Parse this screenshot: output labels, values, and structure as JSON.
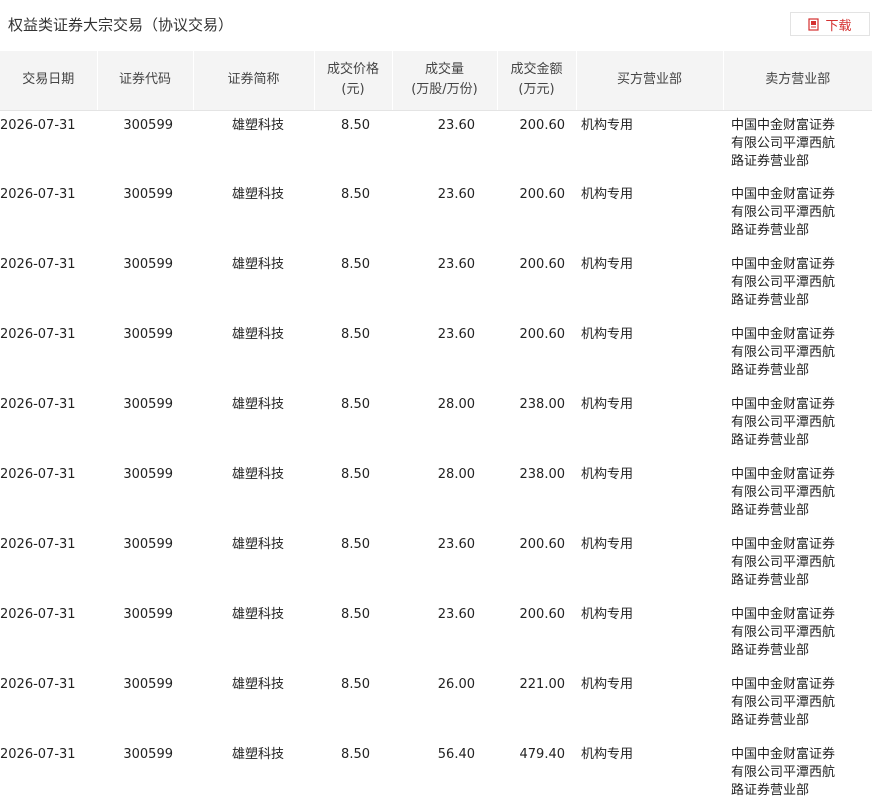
{
  "title": "权益类证券大宗交易（协议交易）",
  "download_label": "下载",
  "accent_color": "#d43030",
  "columns": [
    "交易日期",
    "证券代码",
    "证券简称",
    "成交价格\n(元)",
    "成交量\n(万股/万份)",
    "成交金额\n(万元)",
    "买方营业部",
    "卖方营业部"
  ],
  "rows": [
    {
      "date": "2026-07-31",
      "code": "300599",
      "name": "雄塑科技",
      "price": "8.50",
      "volume": "23.60",
      "amount": "200.60",
      "buyer": "机构专用",
      "seller": "中国中金财富证券有限公司平潭西航路证券营业部"
    },
    {
      "date": "2026-07-31",
      "code": "300599",
      "name": "雄塑科技",
      "price": "8.50",
      "volume": "23.60",
      "amount": "200.60",
      "buyer": "机构专用",
      "seller": "中国中金财富证券有限公司平潭西航路证券营业部"
    },
    {
      "date": "2026-07-31",
      "code": "300599",
      "name": "雄塑科技",
      "price": "8.50",
      "volume": "23.60",
      "amount": "200.60",
      "buyer": "机构专用",
      "seller": "中国中金财富证券有限公司平潭西航路证券营业部"
    },
    {
      "date": "2026-07-31",
      "code": "300599",
      "name": "雄塑科技",
      "price": "8.50",
      "volume": "23.60",
      "amount": "200.60",
      "buyer": "机构专用",
      "seller": "中国中金财富证券有限公司平潭西航路证券营业部"
    },
    {
      "date": "2026-07-31",
      "code": "300599",
      "name": "雄塑科技",
      "price": "8.50",
      "volume": "28.00",
      "amount": "238.00",
      "buyer": "机构专用",
      "seller": "中国中金财富证券有限公司平潭西航路证券营业部"
    },
    {
      "date": "2026-07-31",
      "code": "300599",
      "name": "雄塑科技",
      "price": "8.50",
      "volume": "28.00",
      "amount": "238.00",
      "buyer": "机构专用",
      "seller": "中国中金财富证券有限公司平潭西航路证券营业部"
    },
    {
      "date": "2026-07-31",
      "code": "300599",
      "name": "雄塑科技",
      "price": "8.50",
      "volume": "23.60",
      "amount": "200.60",
      "buyer": "机构专用",
      "seller": "中国中金财富证券有限公司平潭西航路证券营业部"
    },
    {
      "date": "2026-07-31",
      "code": "300599",
      "name": "雄塑科技",
      "price": "8.50",
      "volume": "23.60",
      "amount": "200.60",
      "buyer": "机构专用",
      "seller": "中国中金财富证券有限公司平潭西航路证券营业部"
    },
    {
      "date": "2026-07-31",
      "code": "300599",
      "name": "雄塑科技",
      "price": "8.50",
      "volume": "26.00",
      "amount": "221.00",
      "buyer": "机构专用",
      "seller": "中国中金财富证券有限公司平潭西航路证券营业部"
    },
    {
      "date": "2026-07-31",
      "code": "300599",
      "name": "雄塑科技",
      "price": "8.50",
      "volume": "56.40",
      "amount": "479.40",
      "buyer": "机构专用",
      "seller": "中国中金财富证券有限公司平潭西航路证券营业部"
    }
  ]
}
